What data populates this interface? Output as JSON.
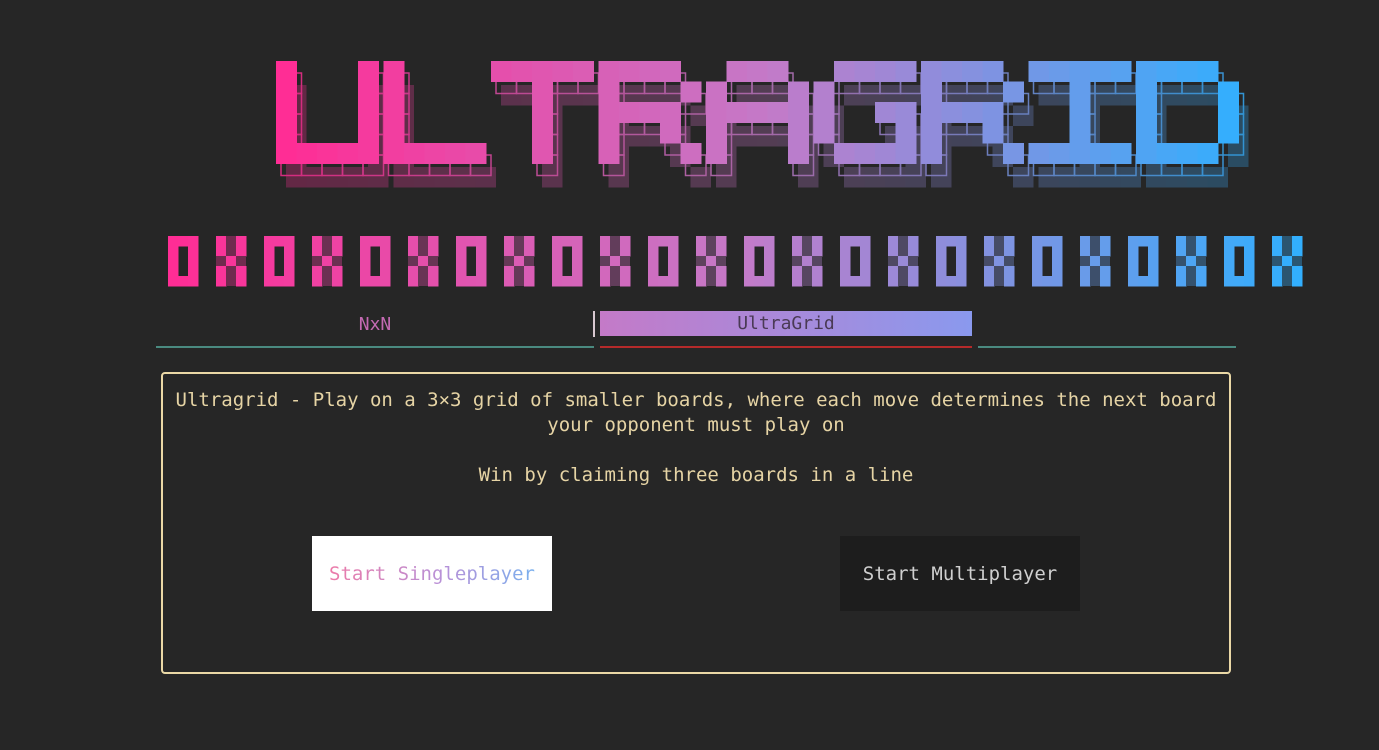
{
  "logo": {
    "title_text": "ULTRAGRID",
    "pattern": "OXOXOXOXOXOXOXOXOXOXOXOX",
    "gradient_start": "#ff2d95",
    "gradient_mid": "#c47ac8",
    "gradient_end": "#2fb0ff"
  },
  "tabs": [
    {
      "label": "NxN",
      "active": false
    },
    {
      "label": "UltraGrid",
      "active": true
    }
  ],
  "panel": {
    "description": "Ultragrid - Play on a 3×3 grid of smaller boards, where each move determines the next board your opponent must play on",
    "win_text": "Win by claiming three boards in a line",
    "singleplayer_label": "Start Singleplayer",
    "multiplayer_label": "Start Multiplayer"
  },
  "colors": {
    "background": "#262626",
    "panel_border": "#ead8a6",
    "text": "#e6d4a5",
    "tab_line": "#4a8a80",
    "active_tab_line": "#b52a2a"
  }
}
